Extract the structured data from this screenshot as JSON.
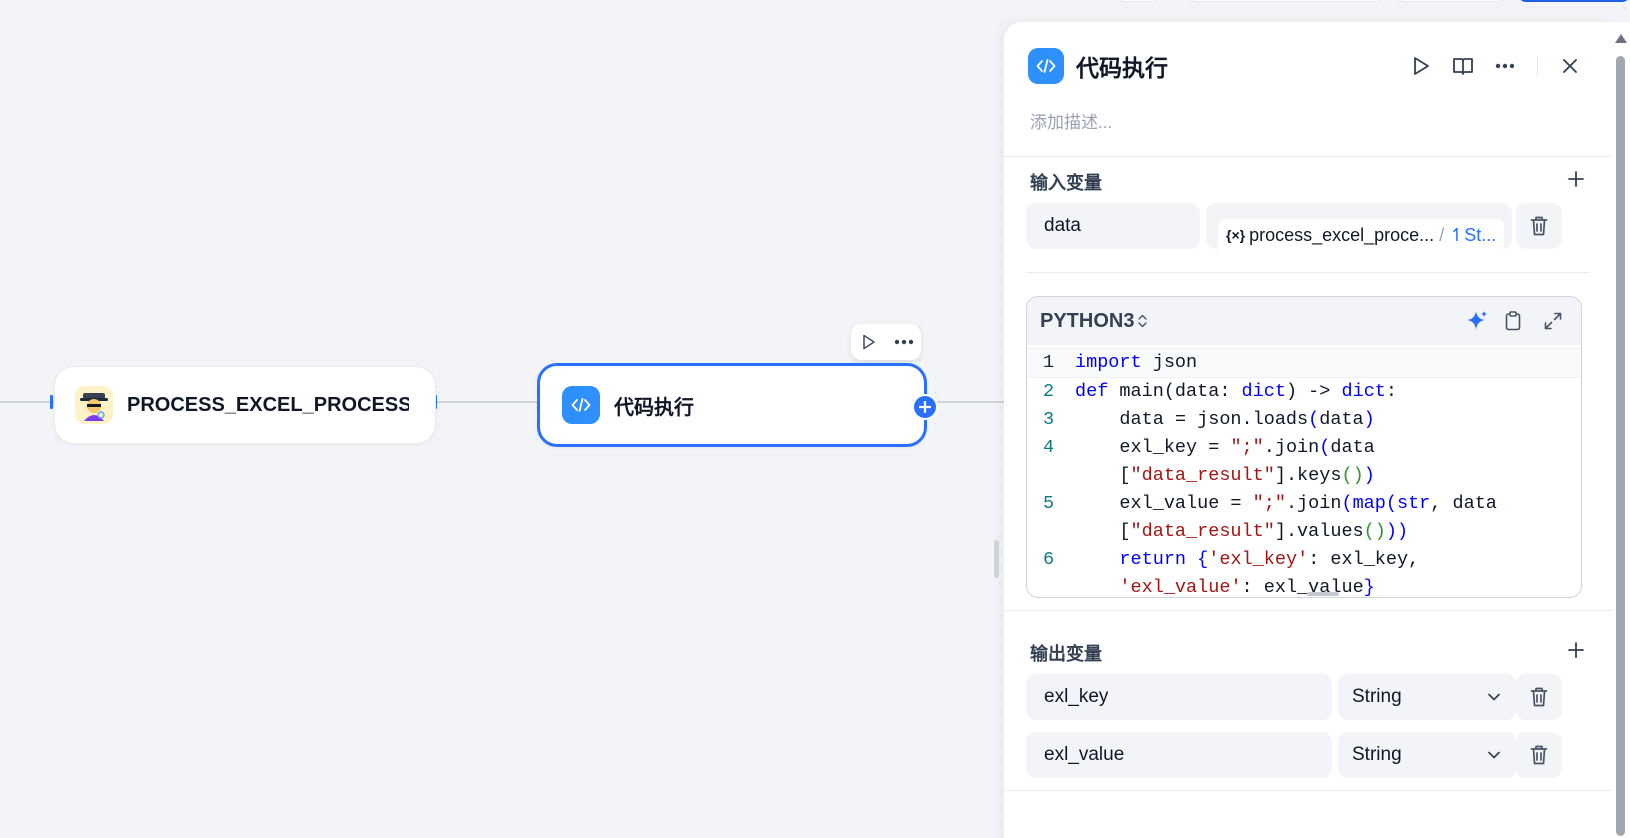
{
  "canvas": {
    "nodes": [
      {
        "title": "PROCESS_EXCEL_PROCESS_",
        "avatar": "detective-emoji-icon"
      },
      {
        "title": "代码执行",
        "icon": "code-icon"
      }
    ],
    "node_toolbar": {
      "run_icon": "play-icon",
      "more_icon": "more-icon"
    }
  },
  "panel": {
    "title": "代码执行",
    "description_placeholder": "添加描述...",
    "actions": [
      "play-icon",
      "book-icon",
      "more-icon",
      "close-icon"
    ],
    "input_section": {
      "label": "输入变量",
      "variables": [
        {
          "name": "data",
          "ref_prefix": "{×}",
          "ref_node": "process_excel_proce...",
          "ref_sep": "/",
          "ref_var": "↿St..."
        }
      ]
    },
    "editor": {
      "language": "PYTHON3",
      "tools": [
        "sparkle-icon",
        "clipboard-icon",
        "expand-icon"
      ],
      "lines": [
        "1",
        "2",
        "3",
        "4",
        "5",
        "6"
      ]
    },
    "output_section": {
      "label": "输出变量",
      "variables": [
        {
          "name": "exl_key",
          "type": "String"
        },
        {
          "name": "exl_value",
          "type": "String"
        }
      ]
    }
  },
  "colors": {
    "accent": "#2970ff",
    "node_icon": "#2e90fa",
    "background": "#f2f4f7"
  }
}
